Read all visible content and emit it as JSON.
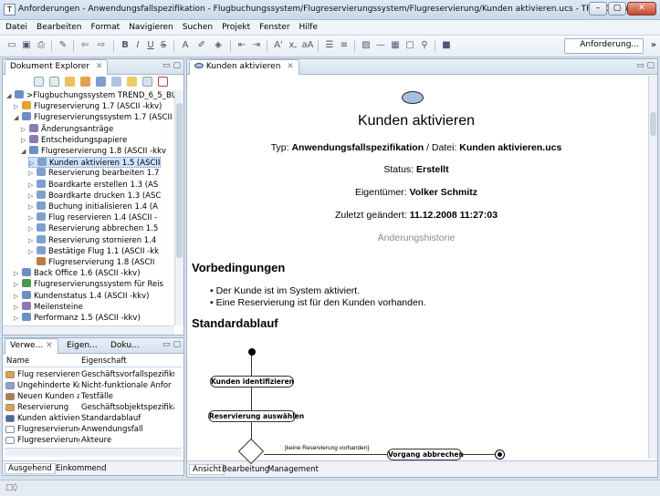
{
  "window": {
    "title": "Anforderungen - Anwendungsfallspezifikation - Flugbuchungssystem/Flugreservierungssystem/Flugreservierung/Kunden aktivieren.ucs - TREND/Analyst",
    "app_icon": "T",
    "controls": [
      "–",
      "▢",
      "✕"
    ]
  },
  "menu": [
    "Datei",
    "Bearbeiten",
    "Format",
    "Navigieren",
    "Suchen",
    "Projekt",
    "Fenster",
    "Hilfe"
  ],
  "toolbar": {
    "perspective_label": "Anforderung...",
    "overflow": "»"
  },
  "explorer": {
    "tab_label": "Dokument Explorer",
    "tree": [
      {
        "label": ">Flugbuchungssystem  TREND_6_5_BU",
        "level": 0,
        "arrow": "◢",
        "color": "#6b8fc7"
      },
      {
        "label": "Flugreservierung  1.7  (ASCII -kkv)",
        "level": 1,
        "arrow": "▷",
        "color": "#e8a030"
      },
      {
        "label": "Flugreservierungssystem  1.7  (ASCII",
        "level": 1,
        "arrow": "◢",
        "color": "#6b8fc7"
      },
      {
        "label": "Änderungsanträge",
        "level": 2,
        "arrow": "▷",
        "color": "#8c7ab8"
      },
      {
        "label": "Entscheidungspapiere",
        "level": 2,
        "arrow": "▷",
        "color": "#8c7ab8"
      },
      {
        "label": "Flugreservierung  1.8  (ASCII -kkv",
        "level": 2,
        "arrow": "◢",
        "color": "#6b8fc7"
      },
      {
        "label": "Kunden aktivieren  1.5  (ASCII",
        "level": 3,
        "arrow": "▷",
        "color": "#7ea0d0",
        "selected": true
      },
      {
        "label": "Reservierung bearbeiten  1.7",
        "level": 3,
        "arrow": "▷",
        "color": "#7ea0d0"
      },
      {
        "label": "Boardkarte erstellen  1.3  (AS",
        "level": 3,
        "arrow": "▷",
        "color": "#7ea0d0"
      },
      {
        "label": "Boardkarte drucken  1.3  (ASC",
        "level": 3,
        "arrow": "▷",
        "color": "#7ea0d0"
      },
      {
        "label": "Buchung initialisieren  1.4  (A",
        "level": 3,
        "arrow": "▷",
        "color": "#7ea0d0"
      },
      {
        "label": "Flug reservieren  1.4  (ASCII -",
        "level": 3,
        "arrow": "▷",
        "color": "#7ea0d0"
      },
      {
        "label": "Reservierung abbrechen  1.5",
        "level": 3,
        "arrow": "▷",
        "color": "#7ea0d0"
      },
      {
        "label": "Reservierung stornieren  1.4",
        "level": 3,
        "arrow": "▷",
        "color": "#7ea0d0"
      },
      {
        "label": "Bestätige Flug  1.1  (ASCII -kk",
        "level": 3,
        "arrow": "▷",
        "color": "#7ea0d0"
      },
      {
        "label": "Flugreservierung  1.8  (ASCII",
        "level": 3,
        "arrow": "",
        "color": "#c07a40"
      },
      {
        "label": "Back Office  1.6  (ASCII -kkv)",
        "level": 1,
        "arrow": "▷",
        "color": "#6b8fc7"
      },
      {
        "label": "Flugreservierungssystem für Reis",
        "level": 1,
        "arrow": "▷",
        "color": "#4a9a4a"
      },
      {
        "label": "Kundenstatus  1.4  (ASCII -kkv)",
        "level": 1,
        "arrow": "▷",
        "color": "#6b8fc7"
      },
      {
        "label": "Meilensteine",
        "level": 1,
        "arrow": "▷",
        "color": "#8c7ab8"
      },
      {
        "label": "Performanz  1.5  (ASCII -kkv)",
        "level": 1,
        "arrow": "▷",
        "color": "#6b8fc7"
      }
    ]
  },
  "props": {
    "tabs": [
      "Verwe...",
      "Eigen...",
      "Doku..."
    ],
    "headers": [
      "Name",
      "Eigenschaft"
    ],
    "rows": [
      {
        "name": "Flug reservieren",
        "prop": "Geschäftsvorfallspezifiku",
        "color": "#e8a030"
      },
      {
        "name": "Ungehinderte Ko...",
        "prop": "Nicht-funktionale Anfor",
        "color": "#8da4c4"
      },
      {
        "name": "Neuen Kunden an...",
        "prop": "Testfälle",
        "color": "#c07a40"
      },
      {
        "name": "Reservierung",
        "prop": "Geschäftsobjektspezifikat",
        "color": "#e8a030"
      },
      {
        "name": "Kunden aktivieren",
        "prop": "Standardablauf",
        "color": "#4a6a9a"
      },
      {
        "name": "Flugreservierung/...",
        "prop": "Anwendungsfall",
        "color": "#ffffff"
      },
      {
        "name": "Flugreservierung/...",
        "prop": "Akteure",
        "color": "#ffffff"
      }
    ],
    "bottom_tabs": [
      "Ausgehend",
      "Einkommend"
    ]
  },
  "editor": {
    "tab_label": "Kunden aktivieren",
    "doc_title": "Kunden aktivieren",
    "type_prefix": "Typ:",
    "type_value": "Anwendungsfallspezifikation",
    "file_prefix": "/ Datei:",
    "file_value": "Kunden aktivieren.ucs",
    "status_prefix": "Status:",
    "status_value": "Erstellt",
    "owner_prefix": "Eigentümer:",
    "owner_value": "Volker Schmitz",
    "changed_prefix": "Zuletzt geändert:",
    "changed_value": "11.12.2008 11:27:03",
    "history_link": "Änderungshistorie",
    "section_pre": "Vorbedingungen",
    "preconditions": [
      "Der Kunde ist im System aktiviert.",
      "Eine Reservierung ist für den Kunden vorhanden."
    ],
    "section_flow": "Standardablauf",
    "diagram": {
      "node1": "Kunden identifizieren",
      "node2": "Reservierung auswählen",
      "guard": "[keine Reservierung vorhanden]",
      "node3": "Vorgang abbrechen"
    },
    "bottom_tabs": [
      "Ansicht",
      "Bearbeitung",
      "Management"
    ]
  },
  "status": {
    "text": "□◊"
  }
}
